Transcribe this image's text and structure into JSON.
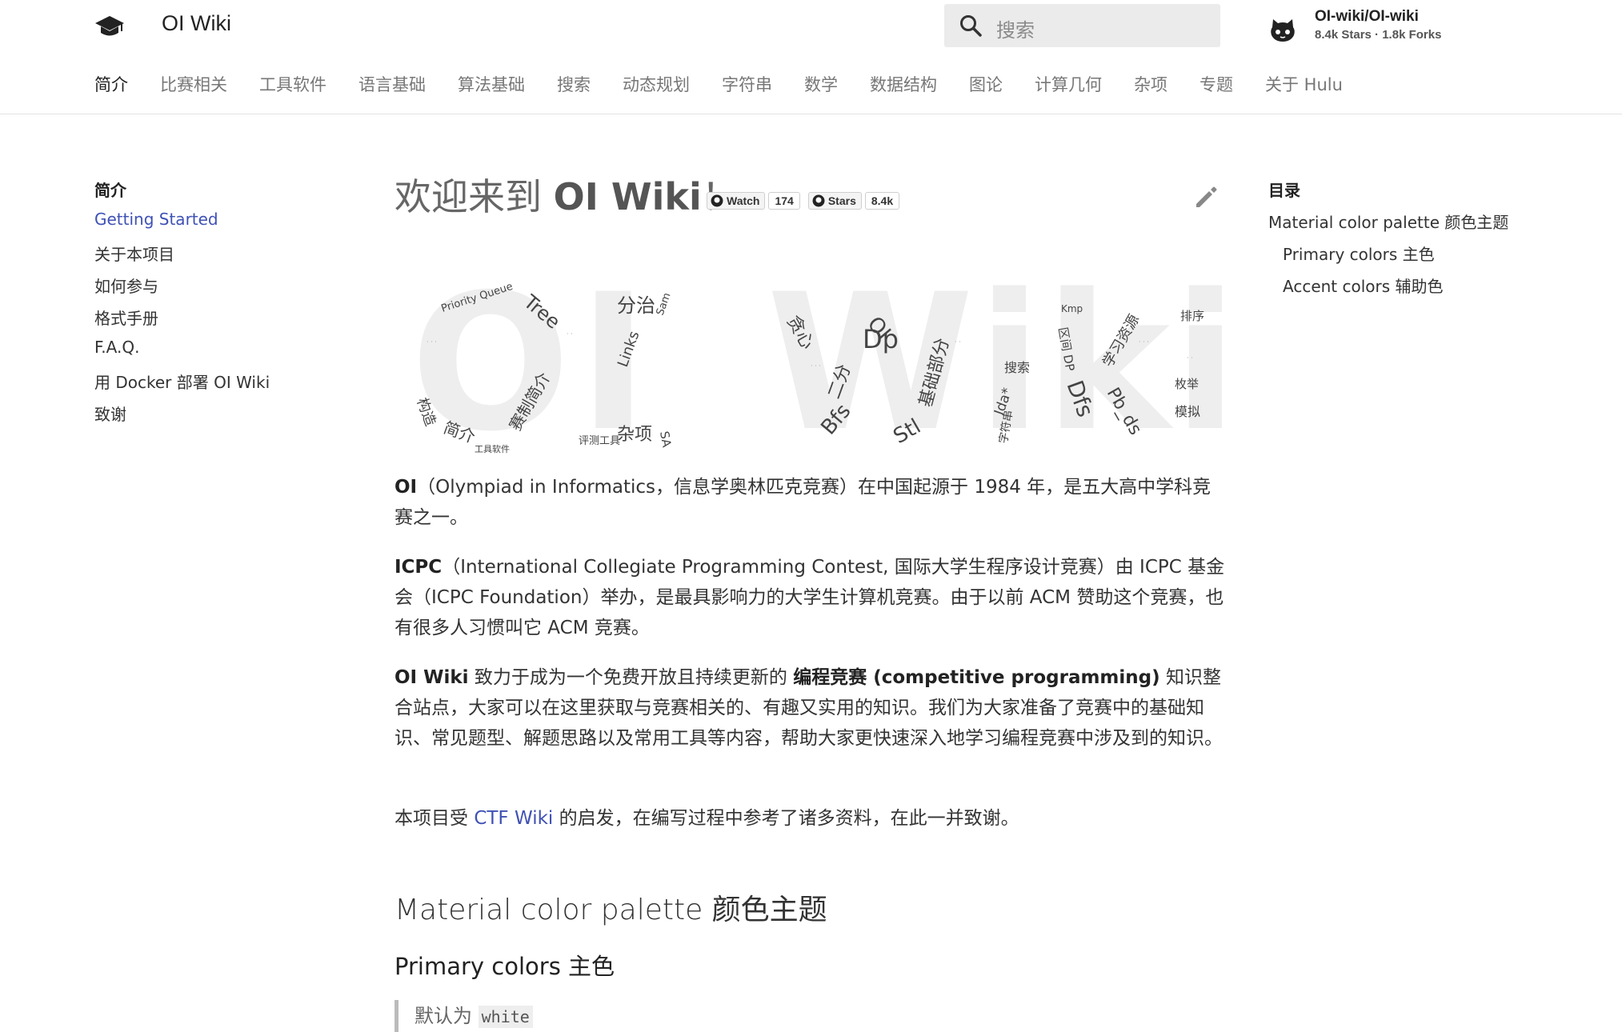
{
  "header": {
    "site_title": "OI Wiki",
    "search_placeholder": "搜索",
    "repo_name": "OI-wiki/OI-wiki",
    "repo_stats": "8.4k Stars · 1.8k Forks"
  },
  "tabs": [
    "简介",
    "比赛相关",
    "工具软件",
    "语言基础",
    "算法基础",
    "搜索",
    "动态规划",
    "字符串",
    "数学",
    "数据结构",
    "图论",
    "计算几何",
    "杂项",
    "专题",
    "关于 Hulu"
  ],
  "leftnav": {
    "heading": "简介",
    "items": [
      "Getting Started",
      "关于本项目",
      "如何参与",
      "格式手册",
      "F.A.Q.",
      "用 Docker 部署 OI Wiki",
      "致谢"
    ]
  },
  "toc": {
    "heading": "目录",
    "items": [
      "Material color palette 颜色主题",
      "Primary colors 主色",
      "Accent colors 辅助色"
    ]
  },
  "main": {
    "title_prefix": "欢迎来到 ",
    "title_bold": "OI Wiki",
    "title_suffix": "！",
    "badges": [
      {
        "label": "Watch",
        "count": "174"
      },
      {
        "label": "Stars",
        "count": "8.4k"
      }
    ],
    "p1_bold": "OI",
    "p1_text": "（Olympiad in Informatics，信息学奥林匹克竞赛）在中国起源于 1984 年，是五大高中学科竞赛之一。",
    "p2_bold": "ICPC",
    "p2_text": "（International Collegiate Programming Contest, 国际大学生程序设计竞赛）由 ICPC 基金会（ICPC Foundation）举办，是最具影响力的大学生计算机竞赛。由于以前 ACM 赞助这个竞赛，也有很多人习惯叫它 ACM 竞赛。",
    "p3_bold1": "OI Wiki",
    "p3_text1": " 致力于成为一个免费开放且持续更新的 ",
    "p3_bold2": "编程竞赛 (competitive programming)",
    "p3_text2": " 知识整合站点，大家可以在这里获取与竞赛相关的、有趣又实用的知识。我们为大家准备了竞赛中的基础知识、常见题型、解题思路以及常用工具等内容，帮助大家更快速深入地学习编程竞赛中涉及到的知识。",
    "p4_pre": "本项目受 ",
    "p4_link": "CTF Wiki",
    "p4_post": " 的启发，在编写过程中参考了诸多资料，在此一并致谢。",
    "h2": "Material color palette 颜色主题",
    "h3": "Primary colors 主色",
    "quote_pre": "默认为 ",
    "quote_code": "white"
  },
  "wordcloud_words": [
    "Priority Queue",
    "Tree",
    "分治",
    "Sam",
    "简介",
    "构造",
    "赛制简介",
    "Links",
    "杂项",
    "SA",
    "工具软件",
    "评测工具",
    "贪心",
    "Dp",
    "OI",
    "Bfs",
    "Stl",
    "二分",
    "基础部分",
    "排序",
    "Dfs",
    "Pb_ds",
    "学习资源",
    "Kmp",
    "区间 DP",
    "搜索",
    "Ida*",
    "模拟",
    "枚举",
    "字符串"
  ],
  "colors": {
    "accent": "#3f51b5",
    "text": "#222222",
    "muted": "#777777",
    "search_bg": "#ebebeb"
  }
}
